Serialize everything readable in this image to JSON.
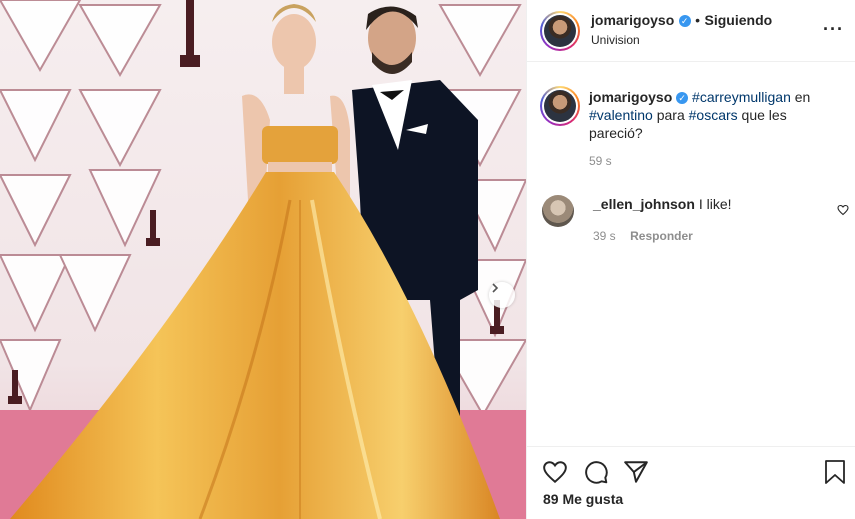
{
  "post": {
    "username": "jomarigoyso",
    "verified_glyph": "✓",
    "separator": "•",
    "follow_label": "Siguiendo",
    "location": "Univision",
    "more_glyph": "···",
    "caption": {
      "username": "jomarigoyso",
      "tag1": "#carreymulligan",
      "text1": " en ",
      "tag2": "#valentino",
      "text2": " para ",
      "tag3": "#oscars",
      "text3": " que les pareció?",
      "time": "59 s"
    },
    "comment": {
      "username": "_ellen_johnson",
      "text": "I like!",
      "time": "39 s",
      "reply_label": "Responder"
    },
    "likes": "89 Me gusta",
    "icons": {
      "like": "heart-icon",
      "comment": "comment-icon",
      "share": "share-icon",
      "save": "bookmark-icon",
      "next": "chevron-right-icon",
      "more": "more-options-icon",
      "comment_like": "heart-icon"
    },
    "colors": {
      "link": "#00376b",
      "verified": "#3897f0",
      "secondary_text": "#8e8e8e"
    }
  }
}
